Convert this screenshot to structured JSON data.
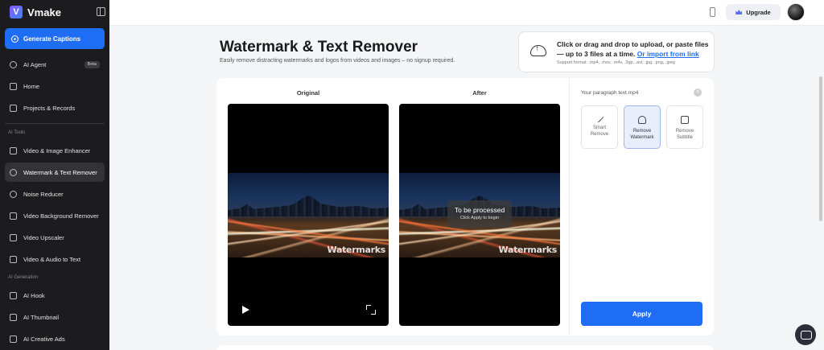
{
  "brand": {
    "name": "Vmake",
    "logo_letter": "V"
  },
  "sidebar": {
    "generate_label": "Generate Captions",
    "ai_agent": {
      "label": "AI Agent",
      "badge": "Beta"
    },
    "home": "Home",
    "projects": "Projects & Records",
    "section_tools": "AI Tools",
    "tools": [
      "Video & Image Enhancer",
      "Watermark & Text Remover",
      "Noise Reducer",
      "Video Background Remover",
      "Video Upscaler",
      "Video & Audio to Text"
    ],
    "section_generation": "AI Generation",
    "generation": [
      "AI Hook",
      "AI Thumbnail",
      "AI Creative Ads"
    ]
  },
  "topbar": {
    "upgrade_label": "Upgrade"
  },
  "header": {
    "title": "Watermark & Text Remover",
    "subtitle": "Easily remove distracting watermarks and logos from videos and images – no signup required."
  },
  "upload": {
    "line1": "Click or drag and drop to upload, or paste files",
    "line2": "— up to 3 files at a time.",
    "link": "Or import from link",
    "formats": "Support format: .mp4, .mov, .m4v, .3gp, .avi, .jpg, .png, .jpeg"
  },
  "preview": {
    "original_label": "Original",
    "after_label": "After",
    "watermark_text": "Watermarks",
    "pending_title": "To be processed",
    "pending_sub": "Click Apply to begin"
  },
  "panel": {
    "file_name": "Your paragraph text.mp4",
    "tools": [
      {
        "line1": "Smart",
        "line2": "Remove"
      },
      {
        "line1": "Remove",
        "line2": "Watermark"
      },
      {
        "line1": "Remove",
        "line2": "Subtitle"
      }
    ],
    "apply_label": "Apply"
  },
  "colors": {
    "accent": "#1f6df5",
    "sidebar_bg": "#1c1c1e"
  }
}
